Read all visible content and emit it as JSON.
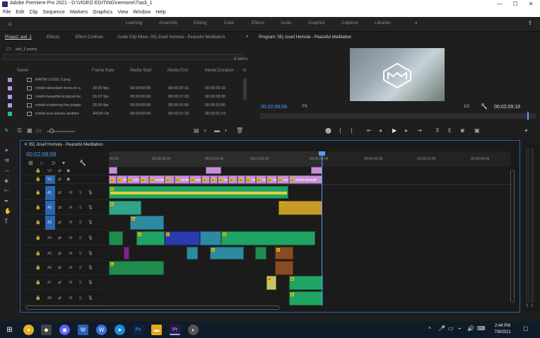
{
  "titlebar": {
    "title": "Adobe Premiere Pro 2021 - D:\\VIDEO EDITING\\nemone\\7\\asli_1"
  },
  "menu": [
    "File",
    "Edit",
    "Clip",
    "Sequence",
    "Markers",
    "Graphics",
    "View",
    "Window",
    "Help"
  ],
  "workspaces": [
    "Learning",
    "Assembly",
    "Editing",
    "Color",
    "Effects",
    "Audio",
    "Graphics",
    "Captions",
    "Libraries"
  ],
  "project": {
    "tabs": [
      "Project: asli_1",
      "Effects",
      "Effect Controls",
      "Audio Clip Mixer: 05) Josef Homola - Peaceful Meditation"
    ],
    "file": "asli_1.prproj",
    "item_count": "9 Items",
    "columns": [
      "Name",
      "Frame Rate",
      "Media Start",
      "Media End",
      "Media Duration",
      "Vi"
    ],
    "rows": [
      {
        "name": "MATIN LOGO 2.png",
        "rate": "",
        "start": "",
        "end": "",
        "dur": "",
        "color": "#c08ad0"
      },
      {
        "name": "miskit-abundant-trees-in-a",
        "rate": "30.00 fps",
        "start": "00:00:00:00",
        "end": "00:00:30:15",
        "dur": "00:00:30:16",
        "color": "#b09ae0"
      },
      {
        "name": "miskit-beautiful-tropical-be",
        "rate": "29.97 fps",
        "start": "00:00:00:00",
        "end": "00:00:17:29",
        "dur": "00:00:18:00",
        "color": "#b09ae0"
      },
      {
        "name": "miskit-exploring-the-jungle-",
        "rate": "25.00 fps",
        "start": "00:00:00:00",
        "end": "00:00:10:00",
        "dur": "00:00:10:00",
        "color": "#b09ae0"
      },
      {
        "name": "miskit-sea-waves-ambien",
        "rate": "44100 Hz",
        "start": "00:00:00:00",
        "end": "00:02:31:18",
        "dur": "00:02:31:19",
        "color": "#25c07a"
      }
    ]
  },
  "program": {
    "title": "Program: 05) Josef Homola - Peaceful Meditation",
    "timecode": "00;02;08;08",
    "fit": "Fit",
    "ratio": "1/2",
    "duration": "00;02;09;18"
  },
  "timeline": {
    "title": "05) Josef Homola - Peaceful Meditation",
    "timecode": "00;02;08;08",
    "ruler": [
      ":00;00",
      "00;00;32;00",
      "00;01;04;02",
      "00;01;56;03",
      "00;02;08;04",
      "00;02;40;06",
      "00;03;12;06",
      "00;03;44;06"
    ],
    "video_tracks": [
      "V2",
      "V1"
    ],
    "audio_tracks": [
      "A1",
      "A2",
      "A3",
      "A4",
      "A5",
      "A6",
      "A7",
      "A8"
    ],
    "track_btns": [
      "M",
      "S"
    ],
    "v1_clip_label": "miskit-beautif",
    "v1_clip_text": "miskit",
    "meter_labels": [
      "S",
      "S"
    ]
  },
  "taskbar": {
    "time": "2:44 PM",
    "date": "7/9/2021"
  }
}
